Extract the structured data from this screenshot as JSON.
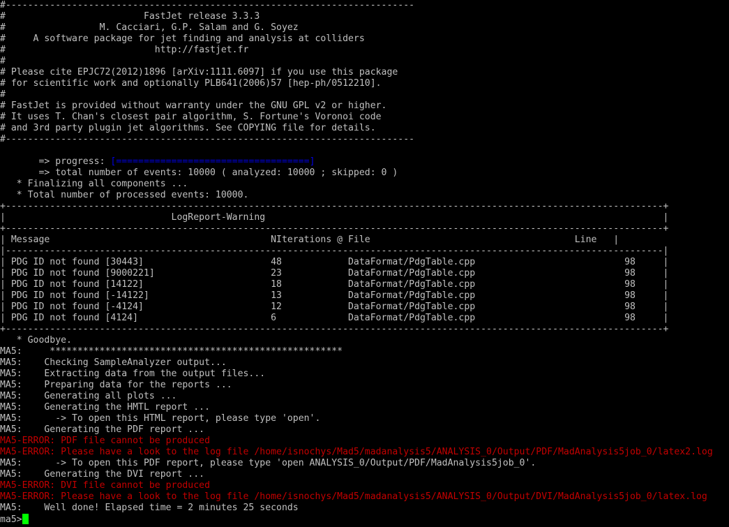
{
  "colors": {
    "background": "#000000",
    "text": "#c0c0c0",
    "error": "#c40000",
    "progress": "#0000e0",
    "cursor": "#00ff00"
  },
  "banner": [
    "#--------------------------------------------------------------------------",
    "#                         FastJet release 3.3.3",
    "#                 M. Cacciari, G.P. Salam and G. Soyez",
    "#     A software package for jet finding and analysis at colliders",
    "#                           http://fastjet.fr",
    "#",
    "# Please cite EPJC72(2012)1896 [arXiv:1111.6097] if you use this package",
    "# for scientific work and optionally PLB641(2006)57 [hep-ph/0512210].",
    "#",
    "# FastJet is provided without warranty under the GNU GPL v2 or higher.",
    "# It uses T. Chan's closest pair algorithm, S. Fortune's Voronoi code",
    "# and 3rd party plugin jet algorithms. See COPYING file for details.",
    "#--------------------------------------------------------------------------"
  ],
  "progress": {
    "label": "       => progress: ",
    "bar": "[===================================]",
    "value": 1.0
  },
  "summary": [
    "       => total number of events: 10000 ( analyzed: 10000 ; skipped: 0 )",
    "   * Finalizing all components ...",
    "   * Total number of processed events: 10000."
  ],
  "warning_table": {
    "border": "+-----------------------------------------------------------------------------------------------------------------------+",
    "title_row": "|                              LogReport-Warning                                                                        |",
    "header_row": "| Message                                        NIterations @ File                                     Line   |",
    "separator": "|-----------------------------------------------------------------------------------------------------------------------|",
    "columns": [
      "Message",
      "NIterations",
      "File",
      "Line"
    ],
    "rows": [
      [
        "PDG ID not found [30443]",
        "48",
        "DataFormat/PdgTable.cpp",
        "98"
      ],
      [
        "PDG ID not found [9000221]",
        "23",
        "DataFormat/PdgTable.cpp",
        "98"
      ],
      [
        "PDG ID not found [14122]",
        "18",
        "DataFormat/PdgTable.cpp",
        "98"
      ],
      [
        "PDG ID not found [-14122]",
        "13",
        "DataFormat/PdgTable.cpp",
        "98"
      ],
      [
        "PDG ID not found [-4124]",
        "12",
        "DataFormat/PdgTable.cpp",
        "98"
      ],
      [
        "PDG ID not found [4124]",
        "6",
        "DataFormat/PdgTable.cpp",
        "98"
      ]
    ]
  },
  "log": [
    {
      "text": "   * Goodbye.",
      "error": false
    },
    {
      "text": "MA5:     *****************************************************",
      "error": false
    },
    {
      "text": "MA5:    Checking SampleAnalyzer output...",
      "error": false
    },
    {
      "text": "MA5:    Extracting data from the output files...",
      "error": false
    },
    {
      "text": "MA5:    Preparing data for the reports ...",
      "error": false
    },
    {
      "text": "MA5:    Generating all plots ...",
      "error": false
    },
    {
      "text": "MA5:    Generating the HMTL report ...",
      "error": false
    },
    {
      "text": "MA5:      -> To open this HTML report, please type 'open'.",
      "error": false
    },
    {
      "text": "MA5:    Generating the PDF report ...",
      "error": false
    },
    {
      "text": "MA5-ERROR: PDF file cannot be produced",
      "error": true
    },
    {
      "text": "MA5-ERROR: Please have a look to the log file /home/isnochys/Mad5/madanalysis5/ANALYSIS_0/Output/PDF/MadAnalysis5job_0/latex2.log",
      "error": true
    },
    {
      "text": "MA5:      -> To open this PDF report, please type 'open ANALYSIS_0/Output/PDF/MadAnalysis5job_0'.",
      "error": false
    },
    {
      "text": "MA5:    Generating the DVI report ...",
      "error": false
    },
    {
      "text": "MA5-ERROR: DVI file cannot be produced",
      "error": true
    },
    {
      "text": "MA5-ERROR: Please have a look to the log file /home/isnochys/Mad5/madanalysis5/ANALYSIS_0/Output/DVI/MadAnalysis5job_0/latex.log",
      "error": true
    },
    {
      "text": "MA5:    Well done! Elapsed time = 2 minutes 25 seconds",
      "error": false
    }
  ],
  "prompt": "ma5>"
}
